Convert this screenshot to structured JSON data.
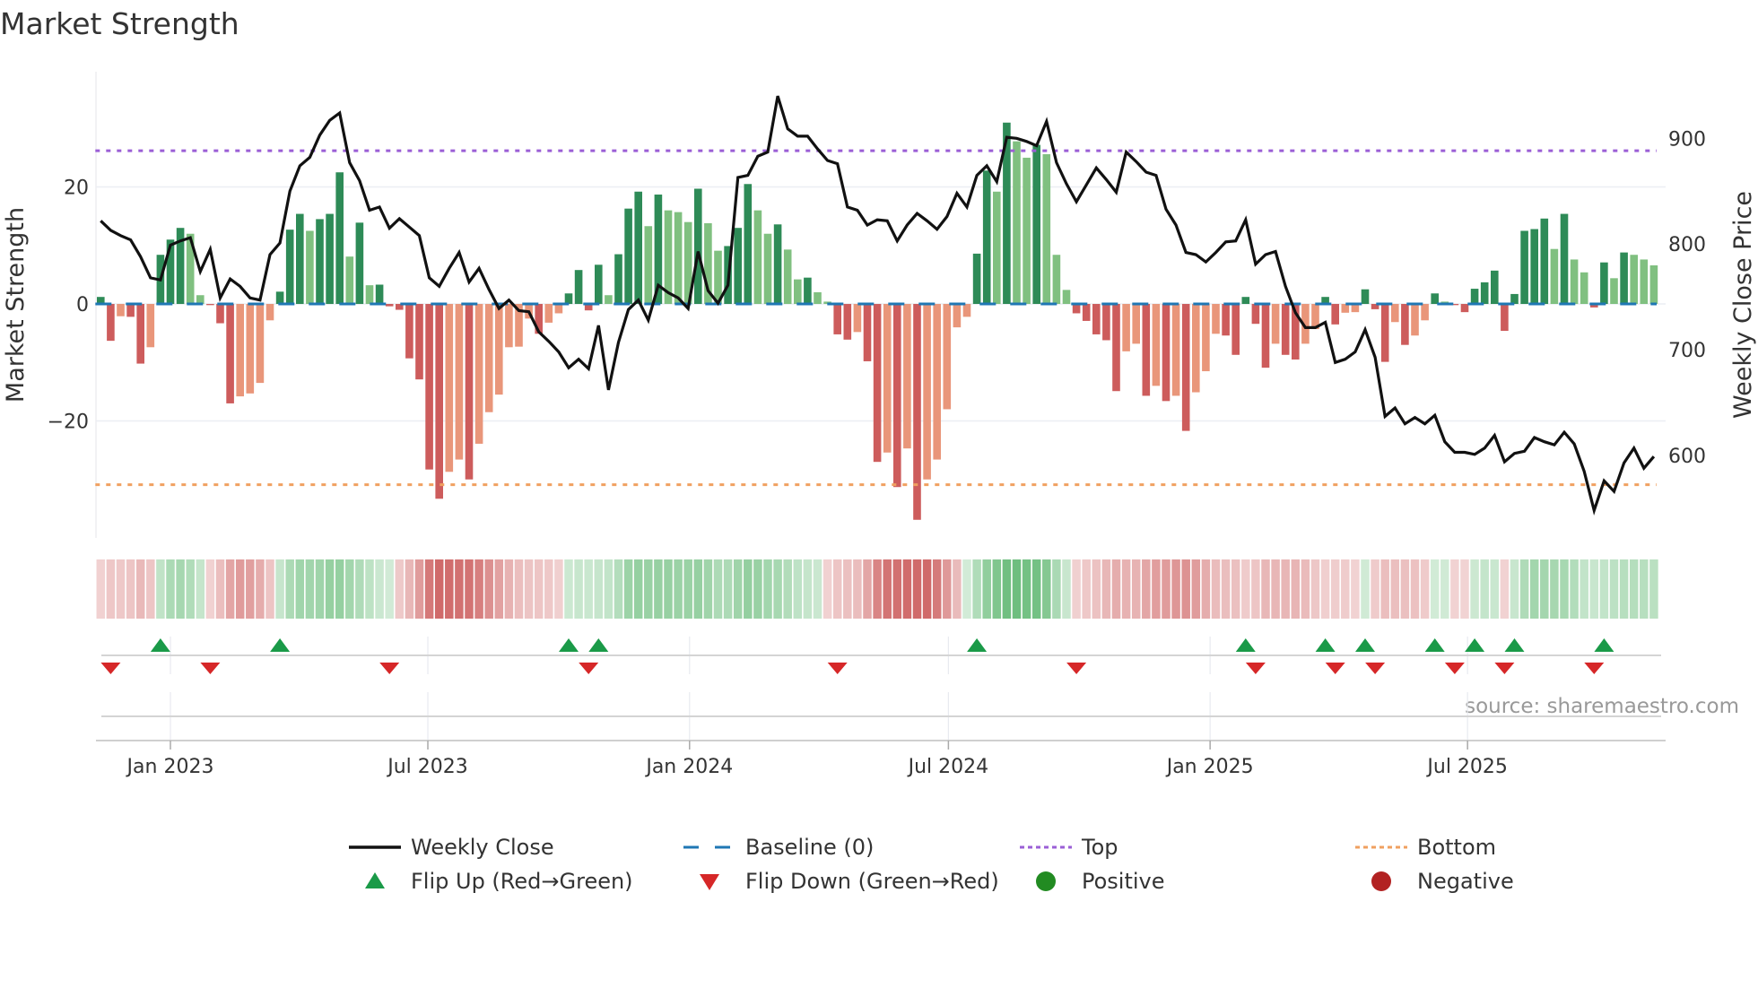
{
  "chart_data": {
    "type": "bar",
    "title": "Market Strength",
    "ylabel": "Market Strength",
    "y2label": "Weekly Close Price",
    "ylim": [
      -40,
      39.7
    ],
    "y2lim": [
      522,
      963
    ],
    "yticks": [
      20,
      0,
      -20
    ],
    "yticklabels": [
      "20",
      "0",
      "−20"
    ],
    "y2ticks": [
      900,
      800,
      700,
      600
    ],
    "start_date": "2022-11-13",
    "interval_days": 7,
    "xticks": [
      {
        "date": "2023-01-01",
        "label": "Jan 2023"
      },
      {
        "date": "2023-07-01",
        "label": "Jul 2023"
      },
      {
        "date": "2024-01-01",
        "label": "Jan 2024"
      },
      {
        "date": "2024-07-01",
        "label": "Jul 2024"
      },
      {
        "date": "2025-01-01",
        "label": "Jan 2025"
      },
      {
        "date": "2025-07-01",
        "label": "Jul 2025"
      }
    ],
    "top_threshold": 26.2,
    "bottom_threshold": -30.9,
    "strength": [
      1.2,
      -6.3,
      -2.1,
      -2.2,
      -10.2,
      -7.4,
      8.4,
      11,
      13,
      12,
      1.5,
      -0.2,
      -3.3,
      -17,
      -15.8,
      -15.3,
      -13.5,
      -2.8,
      2.1,
      12.7,
      15.4,
      12.5,
      14.5,
      15.4,
      22.5,
      8.1,
      13.9,
      3.2,
      3.3,
      -0.4,
      -1,
      -9.3,
      -12.9,
      -28.3,
      -33.3,
      -28.7,
      -26.6,
      -30,
      -23.9,
      -18.5,
      -15.5,
      -7.4,
      -7.3,
      -2.5,
      -5.1,
      -3.2,
      -1.6,
      1.8,
      5.8,
      -1.1,
      6.7,
      1.5,
      8.5,
      16.3,
      19.2,
      13.3,
      18.7,
      16,
      15.7,
      14,
      19.7,
      13.8,
      9.1,
      9.9,
      13,
      20.5,
      16,
      12,
      13.6,
      9.3,
      4.2,
      4.5,
      2,
      0.4,
      -5.2,
      -6.1,
      -4.8,
      -9.8,
      -27,
      -25.4,
      -31.3,
      -24.7,
      -36.9,
      -30,
      -26.6,
      -18,
      -4,
      -2.2,
      8.6,
      22.8,
      19.2,
      31,
      27.8,
      25,
      27.2,
      25.6,
      8.4,
      2.4,
      -1.6,
      -2.9,
      -5.2,
      -6.2,
      -14.9,
      -8.1,
      -6.8,
      -15.7,
      -14,
      -16.6,
      -15.7,
      -21.7,
      -15.1,
      -11.5,
      -5.1,
      -5.4,
      -8.7,
      1.2,
      -3.4,
      -10.9,
      -6.8,
      -8.7,
      -9.5,
      -6.8,
      -4.3,
      1.2,
      -3.5,
      -1.5,
      -1.4,
      2.5,
      -0.9,
      -9.9,
      -3.1,
      -7,
      -5.4,
      -2.8,
      1.8,
      0.4,
      -0.2,
      -1.4,
      2.6,
      3.7,
      5.7,
      -4.6,
      1.7,
      12.5,
      12.8,
      14.6,
      9.4,
      15.4,
      7.6,
      5.4,
      -0.6,
      7.1,
      4.4,
      8.8,
      8.4,
      7.6,
      6.6
    ],
    "weekly_close": [
      822,
      813,
      808,
      804,
      788,
      768,
      766,
      799,
      803,
      806,
      774,
      795,
      749,
      767,
      760,
      749,
      747,
      790,
      801,
      850,
      874,
      882,
      903,
      917,
      924,
      877,
      860,
      832,
      835,
      815,
      824,
      816,
      808,
      768,
      760,
      777,
      792,
      764,
      777,
      757,
      739,
      747,
      737,
      736,
      717,
      708,
      698,
      683,
      691,
      682,
      723,
      662,
      707,
      738,
      747,
      728,
      761,
      754,
      749,
      739,
      793,
      756,
      744,
      761,
      863,
      865,
      883,
      887,
      940,
      909,
      902,
      902,
      890,
      879,
      876,
      835,
      832,
      818,
      823,
      822,
      803,
      818,
      829,
      822,
      814,
      826,
      848,
      835,
      865,
      874,
      859,
      901,
      900,
      897,
      893,
      916,
      877,
      857,
      840,
      856,
      872,
      861,
      849,
      887,
      878,
      868,
      865,
      833,
      818,
      792,
      790,
      783,
      792,
      802,
      803,
      823,
      781,
      790,
      793,
      760,
      735,
      721,
      721,
      726,
      688,
      691,
      698,
      719,
      693,
      637,
      645,
      630,
      636,
      630,
      638,
      613,
      603,
      603,
      601,
      607,
      619,
      594,
      602,
      604,
      617,
      613,
      610,
      622,
      611,
      585,
      548,
      576,
      566,
      593,
      607,
      588,
      599
    ],
    "legend": [
      {
        "label": "Weekly Close",
        "kind": "line"
      },
      {
        "label": "Baseline (0)",
        "kind": "dashed"
      },
      {
        "label": "Top",
        "kind": "dotted-top"
      },
      {
        "label": "Bottom",
        "kind": "dotted-bottom"
      },
      {
        "label": "Flip Up (Red→Green)",
        "kind": "tri-up"
      },
      {
        "label": "Flip Down (Green→Red)",
        "kind": "tri-down"
      },
      {
        "label": "Positive",
        "kind": "dot-pos"
      },
      {
        "label": "Negative",
        "kind": "dot-neg"
      }
    ],
    "legend_position": "bottom",
    "source": "source: sharemaestro.com"
  },
  "colors": {
    "pos_strong": "#2e8b57",
    "pos_weak": "#80c080",
    "neg_strong": "#cd5c5c",
    "neg_weak": "#e9967a",
    "baseline": "#1f77b4",
    "top": "#9b5fd6",
    "bottom": "#f0a060",
    "price": "#111111",
    "flip_up": "#1a9a48",
    "flip_down": "#d62728",
    "positive": "#228b22",
    "negative": "#b22222"
  }
}
